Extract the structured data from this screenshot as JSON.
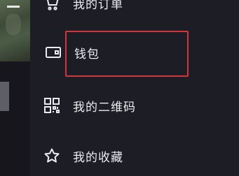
{
  "menu": {
    "items": [
      {
        "label": "我的订单",
        "icon": "cart-icon"
      },
      {
        "label": "钱包",
        "icon": "wallet-icon"
      },
      {
        "label": "我的二维码",
        "icon": "qrcode-icon"
      },
      {
        "label": "我的收藏",
        "icon": "star-icon"
      }
    ]
  },
  "colors": {
    "background": "#1d1d25",
    "text": "#ececf0",
    "highlight": "#d8343e"
  }
}
